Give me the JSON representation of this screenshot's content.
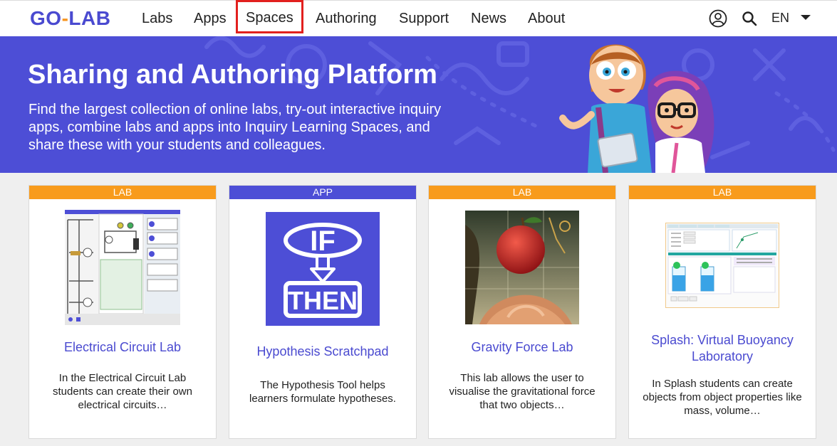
{
  "brand": {
    "logo_left": "GO",
    "logo_dash": "-",
    "logo_right": "LAB",
    "primary": "#4d4ed6",
    "accent": "#f89b1c"
  },
  "nav": {
    "items": [
      {
        "label": "Labs"
      },
      {
        "label": "Apps"
      },
      {
        "label": "Spaces",
        "active": true
      },
      {
        "label": "Authoring"
      },
      {
        "label": "Support"
      },
      {
        "label": "News"
      },
      {
        "label": "About"
      }
    ],
    "icons": [
      "user-icon",
      "search-icon"
    ],
    "language": "EN"
  },
  "hero": {
    "title": "Sharing and Authoring Platform",
    "text": "Find the largest collection of online labs, try-out interactive inquiry apps, combine labs and apps into Inquiry Learning Spaces, and share these with your students and colleagues."
  },
  "cards": [
    {
      "tag": "LAB",
      "title": "Electrical Circuit Lab",
      "description": "In the Electrical Circuit Lab students can create their own electrical circuits…"
    },
    {
      "tag": "APP",
      "title": "Hypothesis Scratchpad",
      "description": "The Hypothesis Tool helps learners formulate hypotheses.",
      "thumb_text_top": "IF",
      "thumb_text_bottom": "THEN"
    },
    {
      "tag": "LAB",
      "title": "Gravity Force Lab",
      "description": "This lab allows the user to visualise the gravitational force that two objects…"
    },
    {
      "tag": "LAB",
      "title": "Splash: Virtual Buoyancy Laboratory",
      "description": "In Splash students can create objects from object properties like mass, volume…"
    }
  ]
}
